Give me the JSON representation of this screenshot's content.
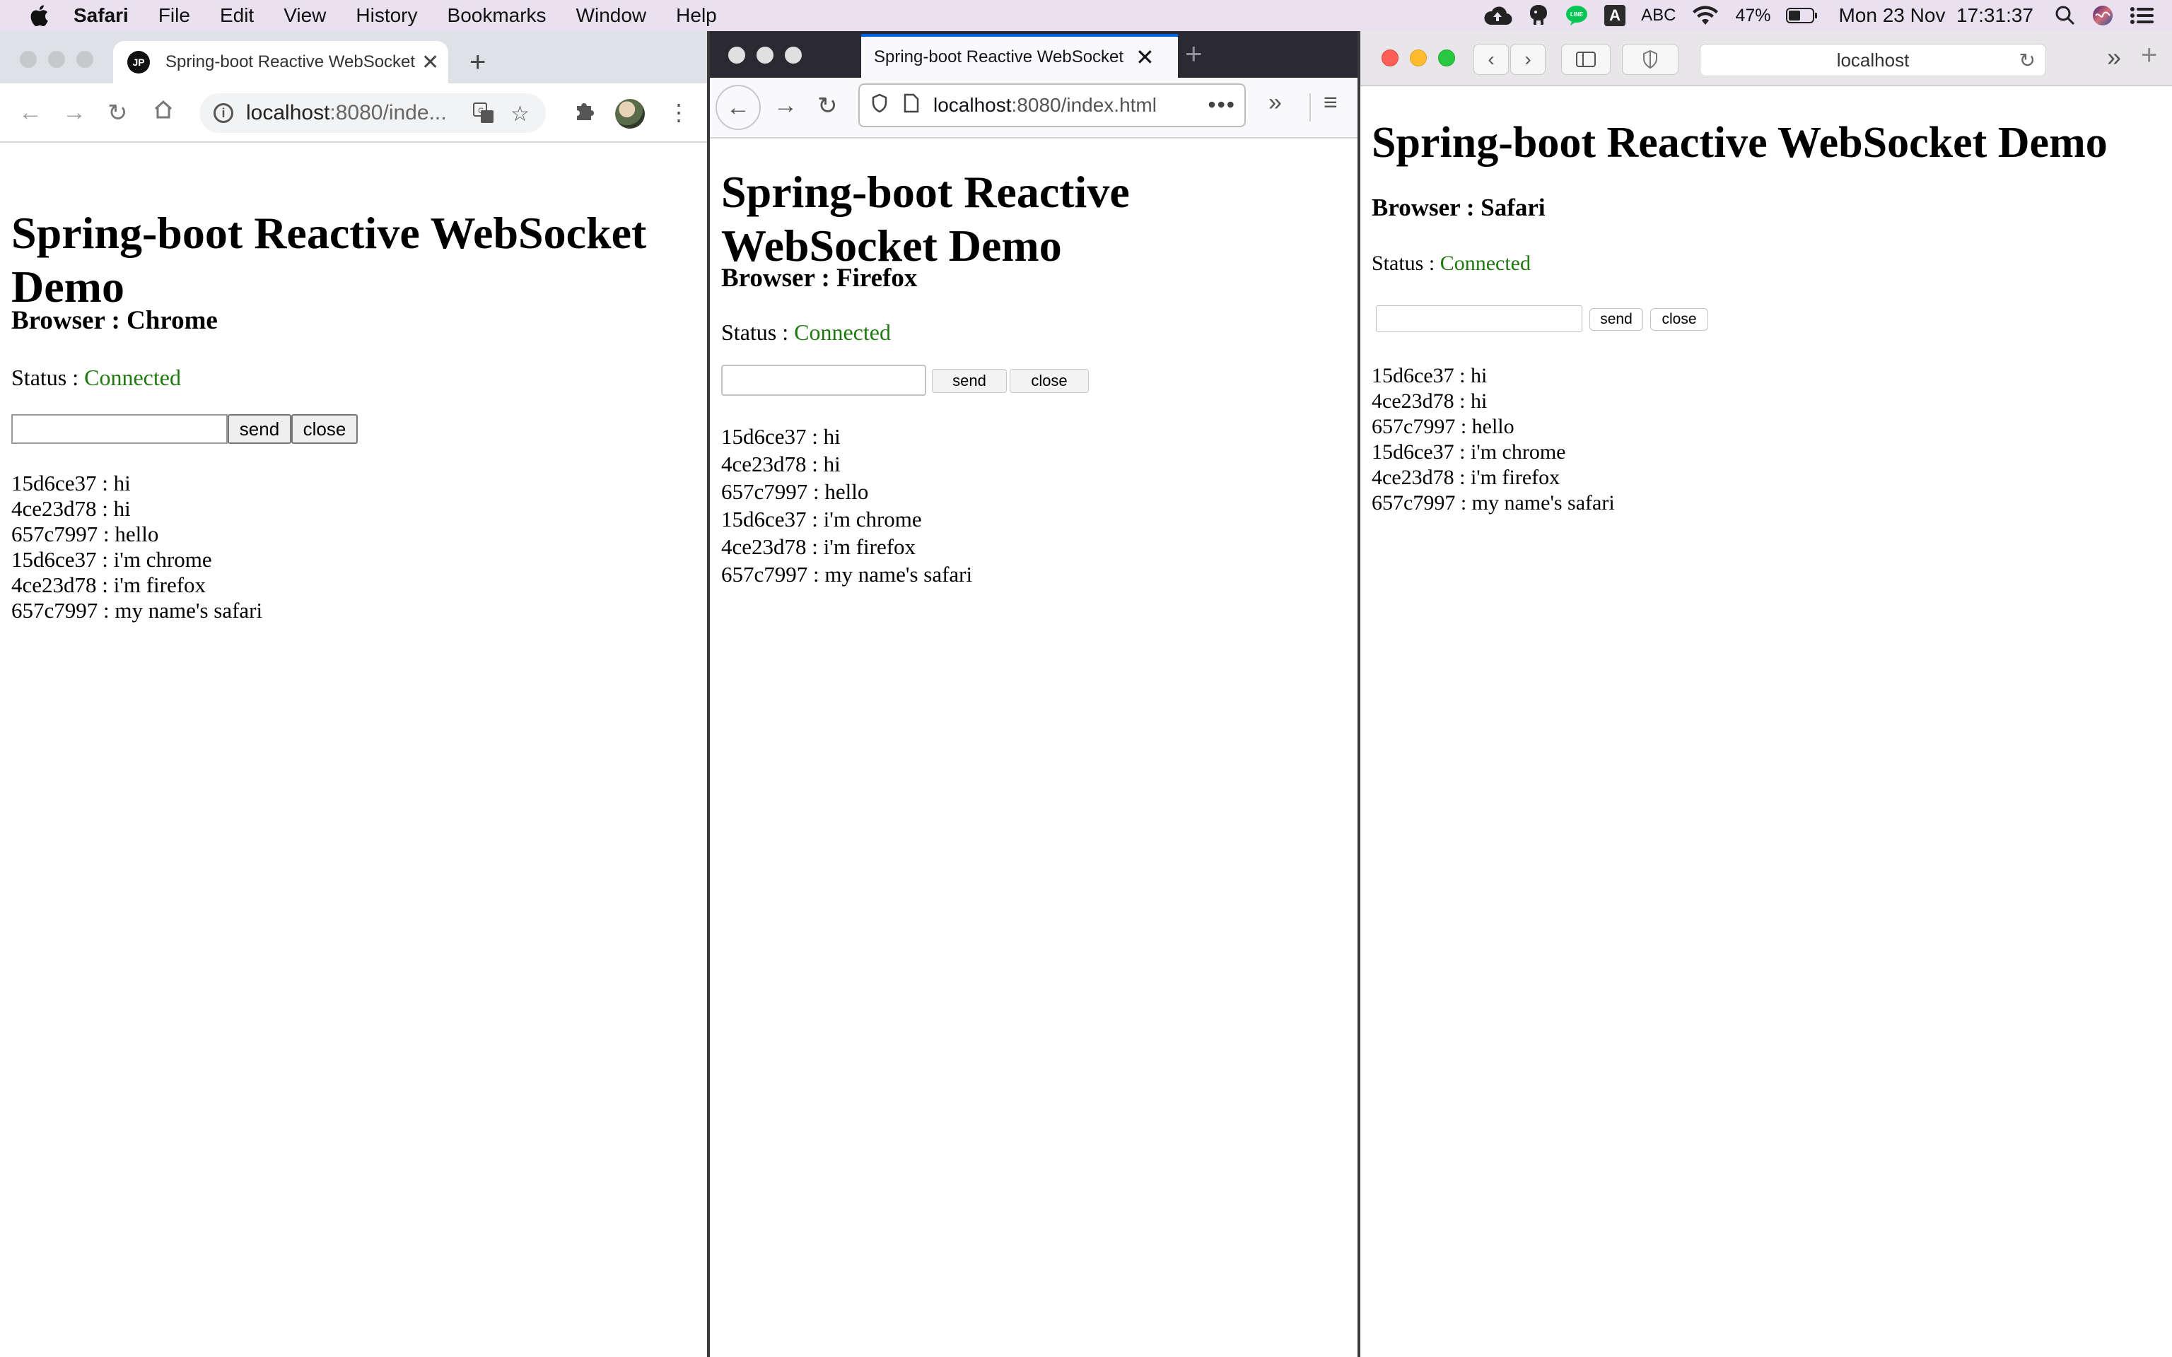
{
  "menubar": {
    "app_name": "Safari",
    "items": [
      "File",
      "Edit",
      "View",
      "History",
      "Bookmarks",
      "Window",
      "Help"
    ],
    "status": {
      "input_source_letter": "A",
      "input_source": "ABC",
      "battery_percent": "47%",
      "datetime": "Mon 23 Nov  17:31:37",
      "line_app_label": "LINE"
    }
  },
  "chrome": {
    "tab_favicon_text": "JP",
    "tab_title": "Spring-boot Reactive WebSocket Demo",
    "url_host": "localhost",
    "url_rest": ":8080/inde...",
    "page": {
      "title": "Spring-boot Reactive WebSocket Demo",
      "browser_label": "Browser : Chrome",
      "status_label": "Status : ",
      "status_value": "Connected",
      "input_value": "",
      "send_label": "send",
      "close_label": "close",
      "messages": [
        "15d6ce37 : hi",
        "4ce23d78 : hi",
        "657c7997 : hello",
        "15d6ce37 : i'm chrome",
        "4ce23d78 : i'm firefox",
        "657c7997 : my name's safari"
      ]
    }
  },
  "firefox": {
    "tab_title": "Spring-boot Reactive WebSocket",
    "url_host": "localhost",
    "url_rest": ":8080/index.html",
    "page": {
      "title": "Spring-boot Reactive WebSocket Demo",
      "browser_label": "Browser : Firefox",
      "status_label": "Status : ",
      "status_value": "Connected",
      "input_value": "",
      "send_label": "send",
      "close_label": "close",
      "messages": [
        "15d6ce37 : hi",
        "4ce23d78 : hi",
        "657c7997 : hello",
        "15d6ce37 : i'm chrome",
        "4ce23d78 : i'm firefox",
        "657c7997 : my name's safari"
      ]
    }
  },
  "safari": {
    "address": "localhost",
    "page": {
      "title": "Spring-boot Reactive WebSocket Demo",
      "browser_label": "Browser : Safari",
      "status_label": "Status : ",
      "status_value": "Connected",
      "input_value": "",
      "send_label": "send",
      "close_label": "close",
      "messages": [
        "15d6ce37 : hi",
        "4ce23d78 : hi",
        "657c7997 : hello",
        "15d6ce37 : i'm chrome",
        "4ce23d78 : i'm firefox",
        "657c7997 : my name's safari"
      ]
    }
  },
  "colors": {
    "status_connected": "#1e7a0f",
    "menubar_bg": "#e9e1f0",
    "firefox_tabstrip": "#2b2a33",
    "firefox_accent": "#0060df"
  }
}
